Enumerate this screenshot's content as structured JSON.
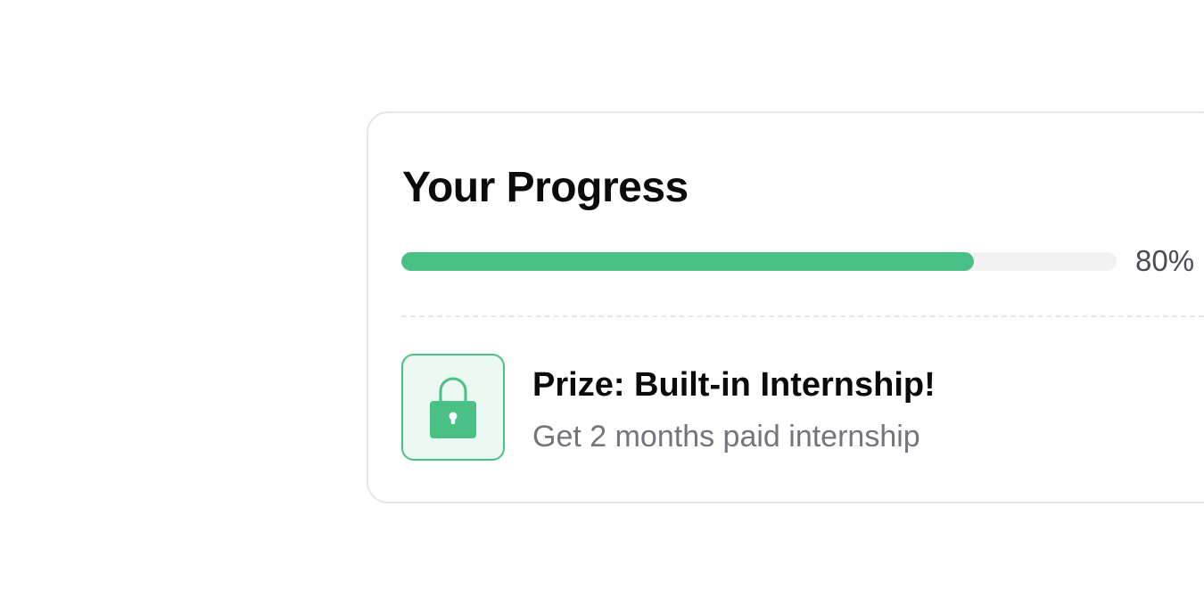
{
  "progress": {
    "title": "Your Progress",
    "value": 0.8,
    "percent_label": "80%",
    "fill_color": "#49c184",
    "track_color": "#f2f2f3"
  },
  "prize": {
    "icon": "lock-icon",
    "title": "Prize: Built-in Internship!",
    "description": "Get 2 months paid internship",
    "accent_color": "#49c184"
  }
}
